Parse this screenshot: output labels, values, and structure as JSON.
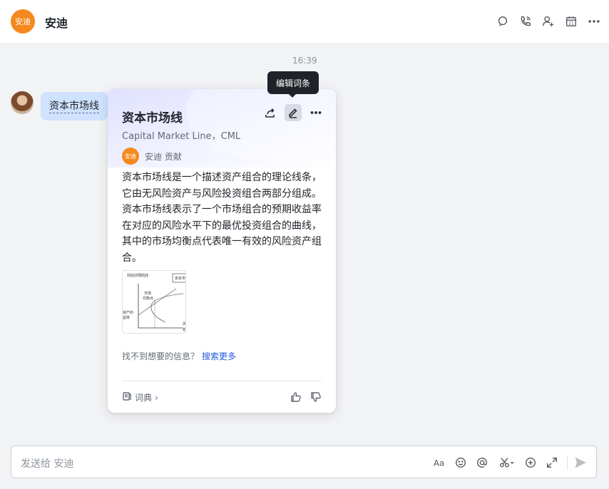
{
  "header": {
    "avatar_text": "安迪",
    "title": "安迪",
    "icons": [
      "search-chat-icon",
      "call-icon",
      "add-member-icon",
      "calendar-icon",
      "more-icon"
    ],
    "calendar_day": "21"
  },
  "messages": {
    "timestamp": "16:39",
    "user_message": "资本市场线"
  },
  "tooltip": "编辑词条",
  "card": {
    "title": "资本市场线",
    "subtitle": "Capital Market Line，CML",
    "contributor_avatar": "安迪",
    "contributor_text": "安迪 贡献",
    "description": "资本市场线是一个描述资产组合的理论线条，它由无风险资产与风险投资组合两部分组成。资本市场线表示了一个市场组合的预期收益率在对应的风险水平下的最优投资组合的曲线，其中的市场均衡点代表唯一有效的风险资产组合。",
    "thumbnail": {
      "ylabel": "风险组合的预期收益率",
      "legend": "资本市",
      "point_label_1": "市场",
      "point_label_2": "均衡点",
      "left_label_1": "资产的",
      "left_label_2": "益率",
      "x_label_1": "风",
      "x_label_2": "析"
    },
    "not_found_text": "找不到想要的信息？",
    "search_more": "搜索更多",
    "dict_label": "词典",
    "dict_chevron": "›"
  },
  "input": {
    "placeholder": "发送给 安迪",
    "font_icon_text": "Aa"
  }
}
